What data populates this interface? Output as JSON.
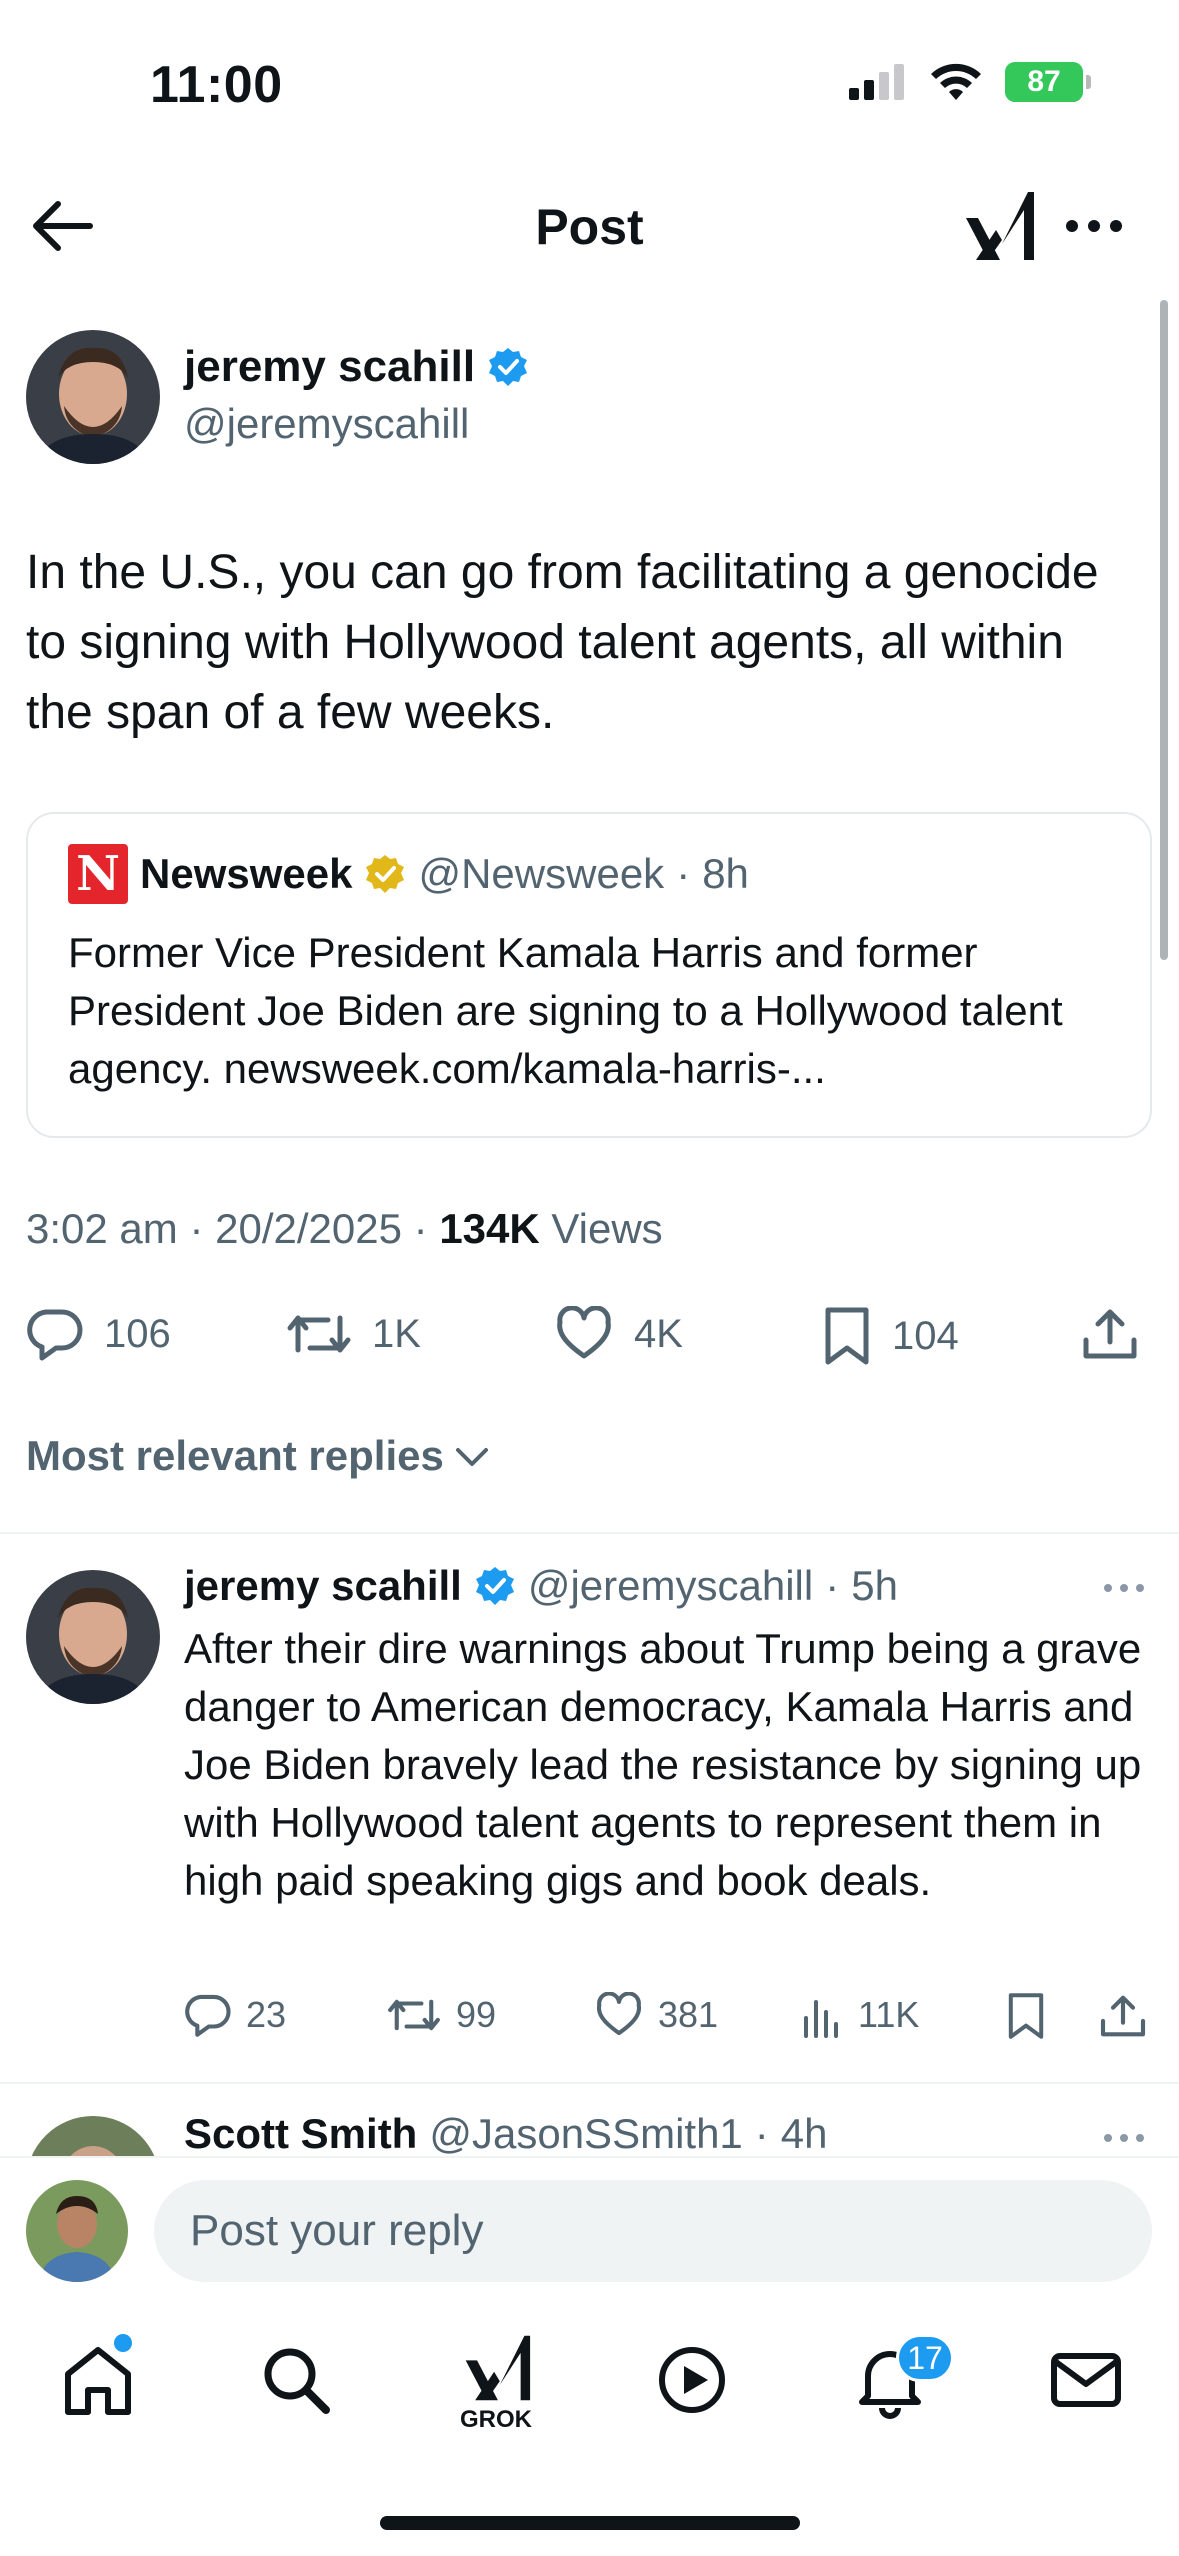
{
  "status_bar": {
    "time": "11:00",
    "battery": "87"
  },
  "header": {
    "title": "Post"
  },
  "post": {
    "author_name": "jeremy scahill",
    "handle": "@jeremyscahill",
    "text": "In the U.S., you can go from facilitating a genocide to signing with Hollywood talent agents, all within the span of a few weeks.",
    "quote": {
      "logo_letter": "N",
      "name": "Newsweek",
      "handle": "@Newsweek",
      "sep": "·",
      "time": "8h",
      "text": "Former Vice President Kamala Harris and former President Joe Biden are signing to a Hollywood talent agency. newsweek.com/kamala-harris-..."
    },
    "time": "3:02 am",
    "date": "20/2/2025",
    "views_count": "134K",
    "views_label": "Views",
    "sep": "·",
    "replies": "106",
    "reposts": "1K",
    "likes": "4K",
    "bookmarks": "104"
  },
  "replies_filter": "Most relevant replies",
  "replies": [
    {
      "author_name": "jeremy scahill",
      "handle": "@jeremyscahill",
      "sep": "·",
      "time": "5h",
      "text": "After their dire warnings about Trump being a grave danger to American democracy, Kamala Harris and Joe Biden bravely lead the resistance by signing up with Hollywood talent agents to represent them in high paid speaking gigs and book deals.",
      "replies": "23",
      "reposts": "99",
      "likes": "381",
      "views": "11K"
    },
    {
      "author_name": "Scott Smith",
      "handle": "@JasonSSmith1",
      "sep": "·",
      "time": "4h"
    }
  ],
  "reply_box": {
    "placeholder": "Post your reply"
  },
  "tabbar": {
    "grok_label": "GROK",
    "notifications_badge": "17"
  },
  "colors": {
    "accent": "#1d9bf0",
    "secondary_text": "#536471",
    "text": "#0f1419",
    "battery": "#34c759",
    "newsweek_red": "#e4252c"
  }
}
